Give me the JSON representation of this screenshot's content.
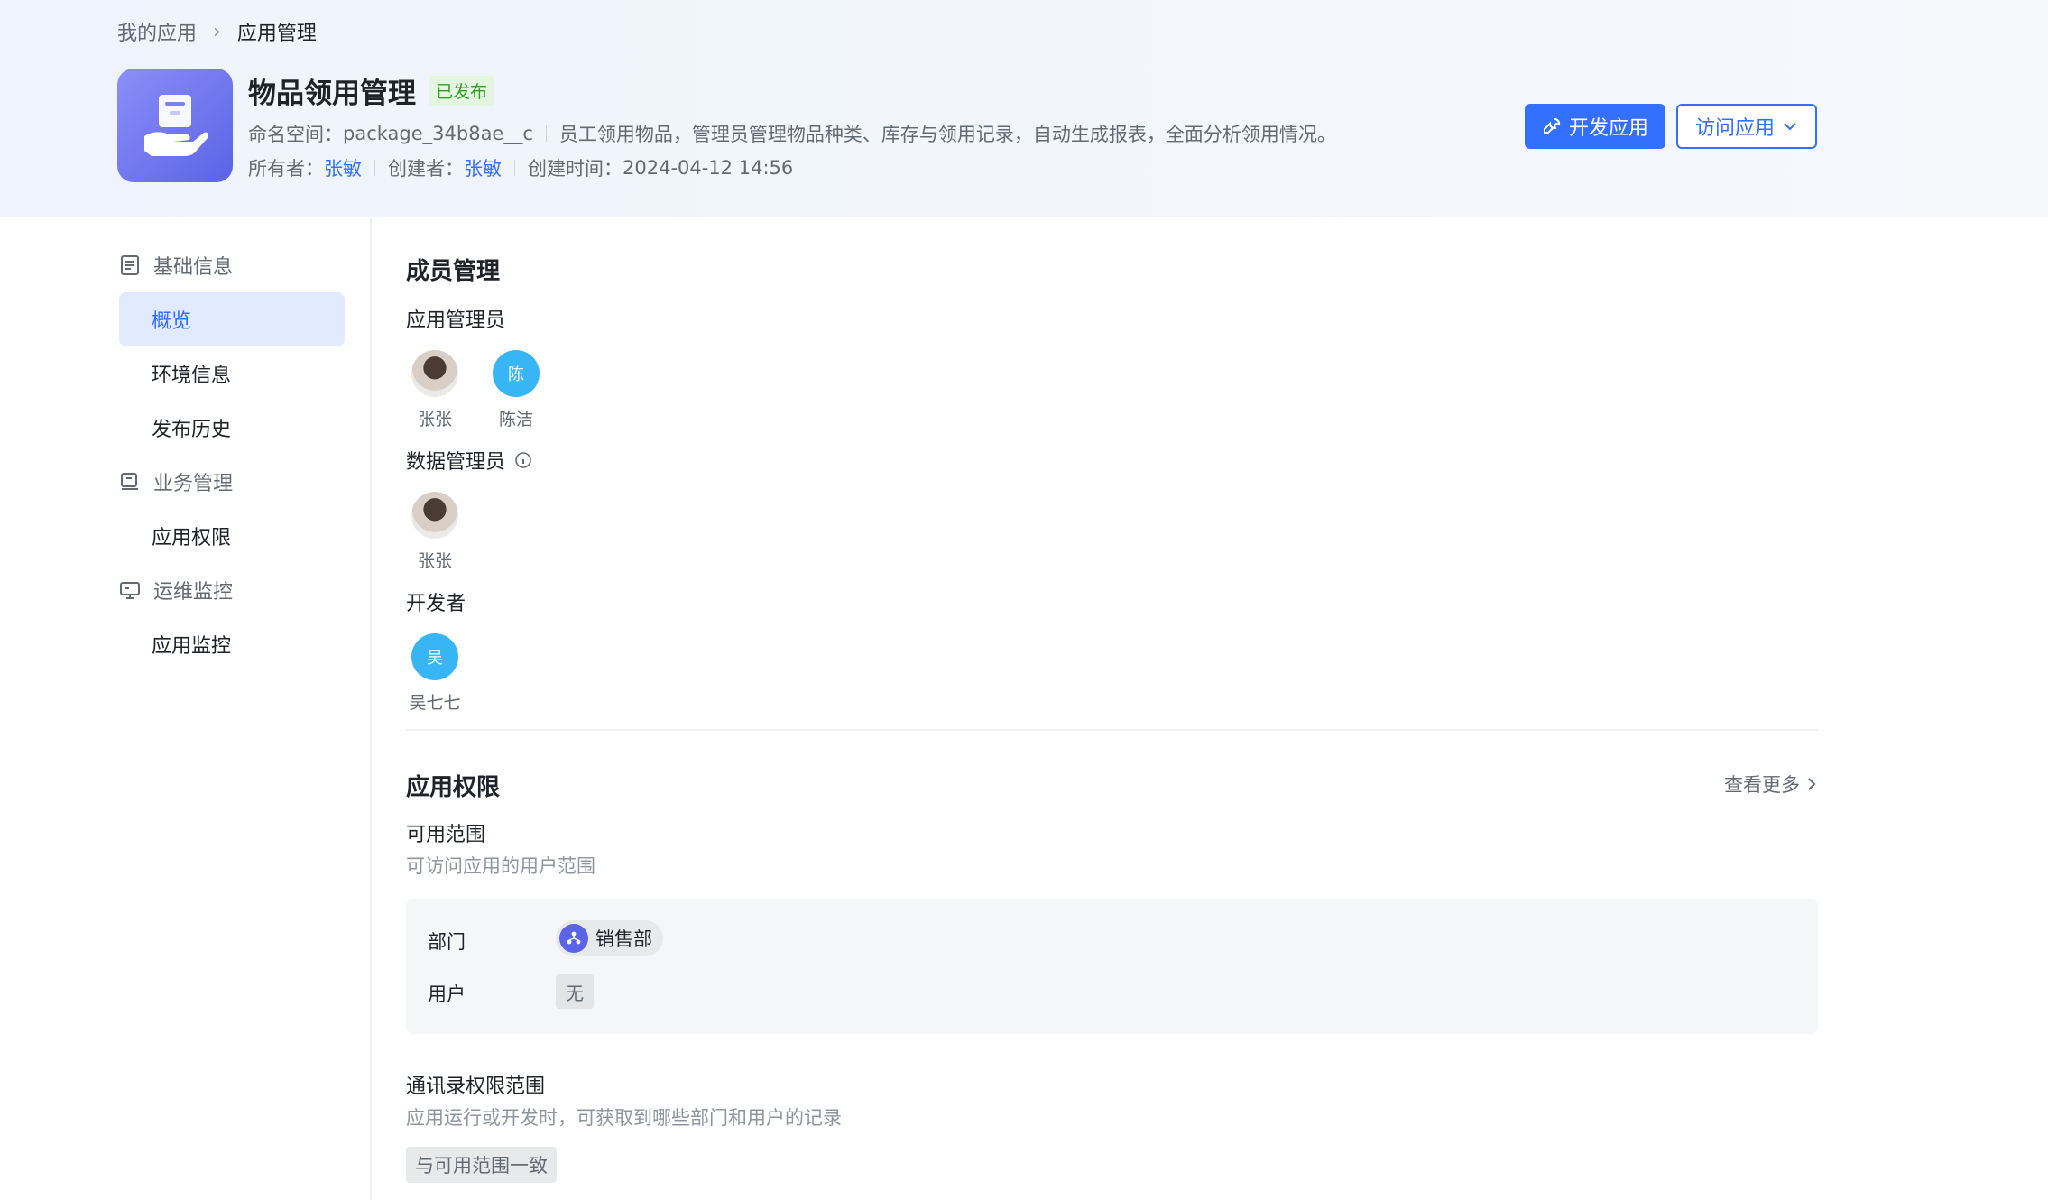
{
  "breadcrumb": {
    "parent": "我的应用",
    "current": "应用管理"
  },
  "app": {
    "title": "物品领用管理",
    "status": "已发布",
    "namespace_label": "命名空间：",
    "namespace": "package_34b8ae__c",
    "description": "员工领用物品，管理员管理物品种类、库存与领用记录，自动生成报表，全面分析领用情况。",
    "owner_label": "所有者：",
    "owner": "张敏",
    "creator_label": "创建者：",
    "creator": "张敏",
    "created_label": "创建时间：",
    "created_time": "2024-04-12 14:56"
  },
  "actions": {
    "develop": "开发应用",
    "visit": "访问应用"
  },
  "sidebar": {
    "groups": [
      {
        "label": "基础信息",
        "icon": "document-icon"
      },
      {
        "label": "业务管理",
        "icon": "briefcase-icon"
      },
      {
        "label": "运维监控",
        "icon": "monitor-icon"
      }
    ],
    "items": [
      "概览",
      "环境信息",
      "发布历史",
      "应用权限",
      "应用监控"
    ]
  },
  "members": {
    "title": "成员管理",
    "app_admins_label": "应用管理员",
    "app_admins": [
      {
        "name": "张张",
        "initial": ""
      },
      {
        "name": "陈洁",
        "initial": "陈"
      }
    ],
    "data_admins_label": "数据管理员",
    "data_admins": [
      {
        "name": "张张",
        "initial": ""
      }
    ],
    "developers_label": "开发者",
    "developers": [
      {
        "name": "吴七七",
        "initial": "吴"
      }
    ]
  },
  "permissions": {
    "title": "应用权限",
    "view_more": "查看更多",
    "scope_title": "可用范围",
    "scope_desc": "可访问应用的用户范围",
    "dept_label": "部门",
    "dept_value": "销售部",
    "user_label": "用户",
    "user_value": "无",
    "contacts_title": "通讯录权限范围",
    "contacts_desc": "应用运行或开发时，可获取到哪些部门和用户的记录",
    "contacts_value": "与可用范围一致"
  },
  "colors": {
    "accent": "#3370ff",
    "published": "#2ea121",
    "avatar_blue": "#37b5f5"
  }
}
